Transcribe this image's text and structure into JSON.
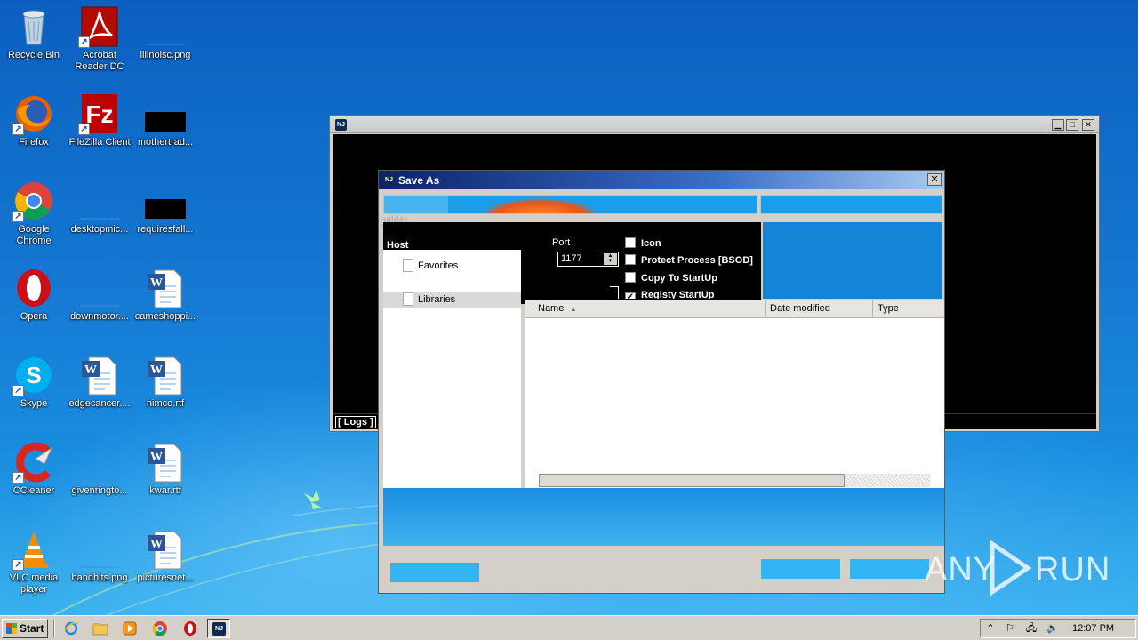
{
  "desktop": {
    "icons": [
      {
        "label": "Recycle Bin"
      },
      {
        "label": "Acrobat Reader DC"
      },
      {
        "label": "illinoisc.png"
      },
      {
        "label": "Firefox"
      },
      {
        "label": "FileZilla Client"
      },
      {
        "label": "mothertrad..."
      },
      {
        "label": "Google Chrome"
      },
      {
        "label": "desktopmic..."
      },
      {
        "label": "requiresfall..."
      },
      {
        "label": "Opera"
      },
      {
        "label": "downmotor...."
      },
      {
        "label": "cameshoppi..."
      },
      {
        "label": "Skype"
      },
      {
        "label": "edgecancer...."
      },
      {
        "label": "himco.rtf"
      },
      {
        "label": "CCleaner"
      },
      {
        "label": "givenringto..."
      },
      {
        "label": "kwar.rtf"
      },
      {
        "label": "VLC media player"
      },
      {
        "label": "handhits.png"
      },
      {
        "label": "picturesnet..."
      }
    ]
  },
  "builder": {
    "logo": "NJ",
    "logs_label": "[ Logs ]",
    "host_label": "Host",
    "port_label": "Port",
    "port_value": "1177",
    "section_tab": "uilder",
    "options": [
      {
        "label": "Icon",
        "checked": false
      },
      {
        "label": "Protect Process [BSOD]",
        "checked": false
      },
      {
        "label": "Copy To StartUp",
        "checked": false
      },
      {
        "label": "Registy StartUp",
        "checked": true
      }
    ]
  },
  "save_dialog": {
    "title": "Save As",
    "close_glyph": "✕",
    "nav": [
      {
        "label": "Favorites"
      },
      {
        "label": "Libraries"
      }
    ],
    "columns": [
      {
        "label": "Name",
        "sort": "ascending"
      },
      {
        "label": "Date modified"
      },
      {
        "label": "Type"
      }
    ]
  },
  "watermark": {
    "text_left": "ANY",
    "text_right": "RUN"
  },
  "taskbar": {
    "start_label": "Start",
    "pinned_icons": [
      "ie-icon",
      "explorer-icon",
      "media-player-icon",
      "chrome-icon",
      "opera-icon",
      "njrat-icon"
    ],
    "clock": "12:07 PM"
  },
  "colors": {
    "desktop_blue": "#1573c9",
    "dialog_title": "#0a246a",
    "glitch_blue": "#33b4f5"
  }
}
